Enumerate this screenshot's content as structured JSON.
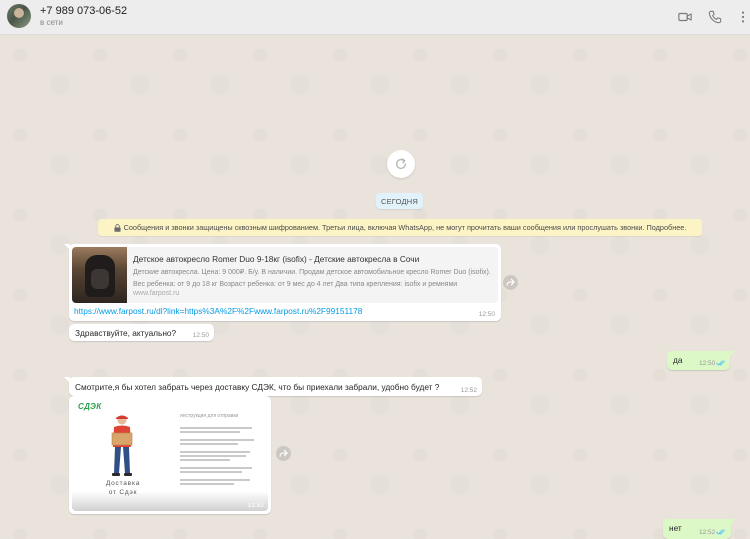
{
  "header": {
    "contact_name": "+7 989 073-06-52",
    "status": "в сети",
    "icons": [
      "video-call-icon",
      "voice-call-icon",
      "menu-icon"
    ]
  },
  "chat": {
    "date_label": "СЕГОДНЯ",
    "encryption_notice": "Сообщения и звонки защищены сквозным шифрованием. Третьи лица, включая WhatsApp, не могут прочитать ваши сообщения или прослушать звонки. Подробнее.",
    "messages": [
      {
        "direction": "in",
        "type": "link",
        "preview_title": "Детское автокресло Romer Duo 9-18кг (isofix) - Детские автокресла в Сочи",
        "preview_description": "Детские автокресла. Цена: 9 000₽. Б/у. В наличии. Продам детское автомобильное кресло Romer Duo (isofix). Вес ребенка: от 9 до 18 кг Возраст ребенка: от 9 мес до 4 лет Два типа крепления: isofix и ремнями",
        "preview_domain": "www.farpost.ru",
        "link": "https://www.farpost.ru/dl?link=https%3A%2F%2Fwww.farpost.ru%2F99151178",
        "time": "12:50"
      },
      {
        "direction": "in",
        "type": "text",
        "text": "Здравствуйте, актуально?",
        "time": "12:50"
      },
      {
        "direction": "out",
        "type": "text",
        "text": "да",
        "time": "12:50",
        "read": true
      },
      {
        "direction": "in",
        "type": "text",
        "text": "Смотрите,я бы хотел забрать через доставку СДЭК, что бы приехали забрали, удобно будет ?",
        "time": "12:52"
      },
      {
        "direction": "in",
        "type": "image",
        "image_logo": "СДЭК",
        "image_caption_line1": "Доставка",
        "image_caption_line2": "от Сдэк",
        "image_heading": "инструкция для отправки",
        "time": "12:52"
      },
      {
        "direction": "out",
        "type": "text",
        "text": "нет",
        "time": "12:52",
        "read": true
      }
    ]
  },
  "colors": {
    "header_bg": "#ededed",
    "incoming_bubble": "#ffffff",
    "outgoing_bubble": "#dcf8c6",
    "date_chip": "#e1f2fb",
    "notice_bg": "#fdf4c5",
    "link": "#039be5",
    "read_ticks": "#4fc3f7",
    "cdek_green": "#2ba14b"
  }
}
